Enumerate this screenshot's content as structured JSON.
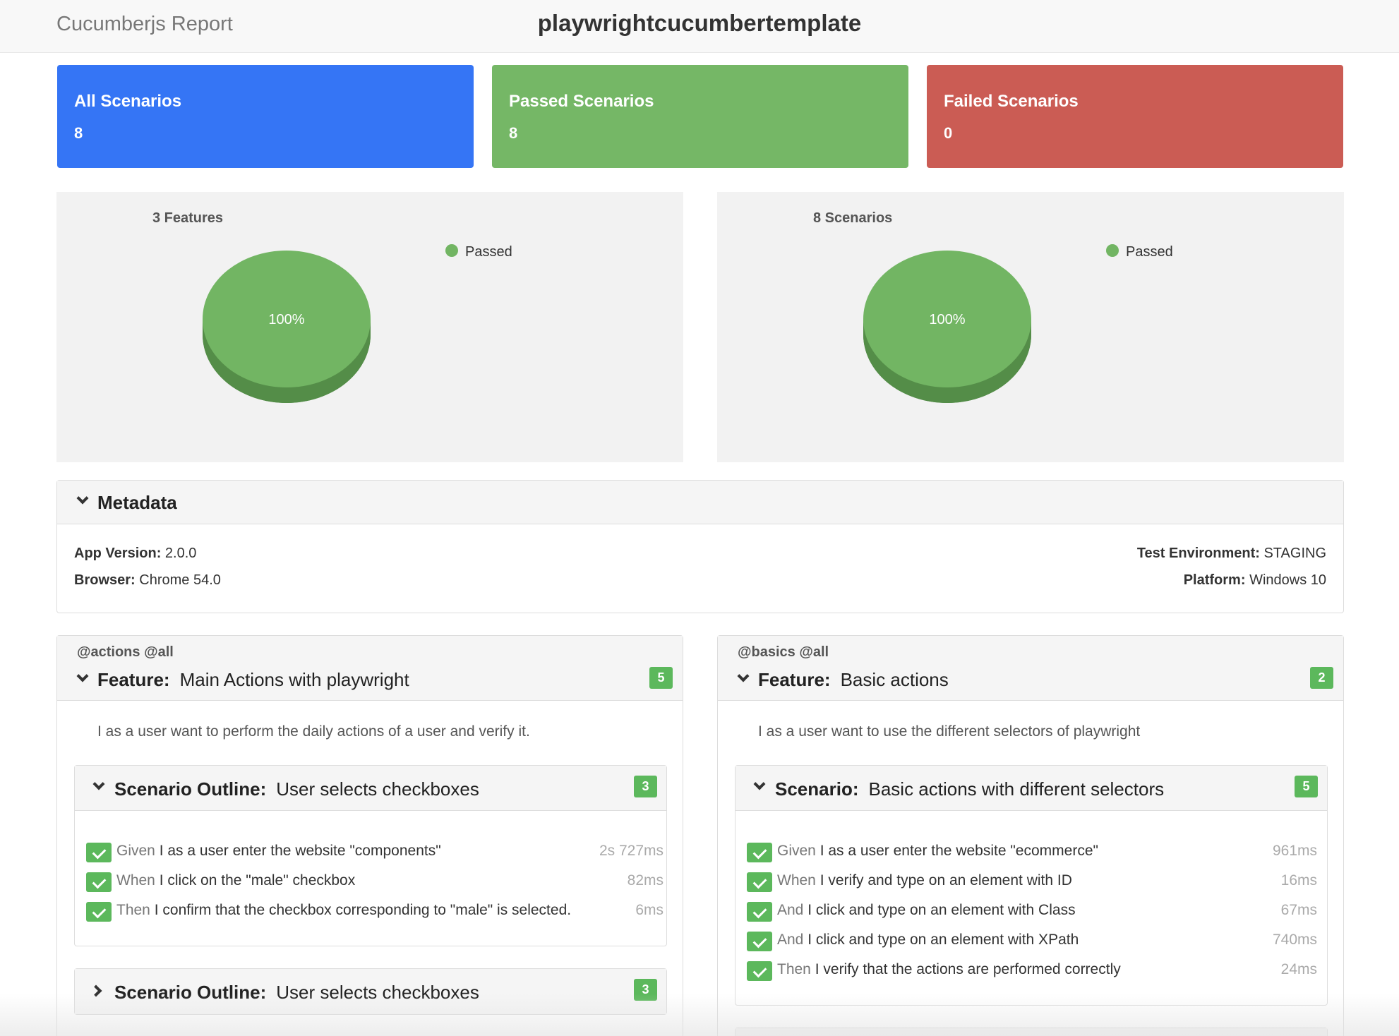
{
  "navbar": {
    "brand": "Cucumberjs Report",
    "title": "playwrightcucumbertemplate"
  },
  "tiles": [
    {
      "label": "All Scenarios",
      "count": "8",
      "color": "#3575f5"
    },
    {
      "label": "Passed Scenarios",
      "count": "8",
      "color": "#75b766"
    },
    {
      "label": "Failed Scenarios",
      "count": "0",
      "color": "#cb5c54"
    }
  ],
  "charts": [
    {
      "title": "3 Features",
      "legend": "Passed",
      "slice_label": "100%",
      "color": "#72b563"
    },
    {
      "title": "8 Scenarios",
      "legend": "Passed",
      "slice_label": "100%",
      "color": "#72b563"
    }
  ],
  "metadata": {
    "title": "Metadata",
    "app_version_label": "App Version:",
    "app_version": "2.0.0",
    "browser_label": "Browser:",
    "browser": "Chrome 54.0",
    "test_env_label": "Test Environment:",
    "test_env": "STAGING",
    "platform_label": "Platform:",
    "platform": "Windows 10"
  },
  "features": [
    {
      "tags": "@actions @all",
      "keyword": "Feature:",
      "name": "Main Actions with playwright",
      "count": "5",
      "description": "I as a user want to perform the daily actions of a user and verify it.",
      "scenarios": [
        {
          "keyword": "Scenario Outline:",
          "name": "User selects checkboxes",
          "count": "3",
          "steps": [
            {
              "keyword": "Given",
              "text": "I as a user enter the website \"components\"",
              "duration": "2s 727ms"
            },
            {
              "keyword": "When",
              "text": "I click on the \"male\" checkbox",
              "duration": "82ms"
            },
            {
              "keyword": "Then",
              "text": "I confirm that the checkbox corresponding to \"male\" is selected.",
              "duration": "6ms"
            }
          ]
        },
        {
          "keyword": "Scenario Outline:",
          "name": "User selects checkboxes",
          "count": "3"
        }
      ]
    },
    {
      "tags": "@basics @all",
      "keyword": "Feature:",
      "name": "Basic actions",
      "count": "2",
      "description": "I as a user want to use the different selectors of playwright",
      "scenarios": [
        {
          "keyword": "Scenario:",
          "name": "Basic actions with different selectors",
          "count": "5",
          "steps": [
            {
              "keyword": "Given",
              "text": "I as a user enter the website \"ecommerce\"",
              "duration": "961ms"
            },
            {
              "keyword": "When",
              "text": "I verify and type on an element with ID",
              "duration": "16ms"
            },
            {
              "keyword": "And",
              "text": "I click and type on an element with Class",
              "duration": "67ms"
            },
            {
              "keyword": "And",
              "text": "I click and type on an element with XPath",
              "duration": "740ms"
            },
            {
              "keyword": "Then",
              "text": "I verify that the actions are performed correctly",
              "duration": "24ms"
            }
          ]
        }
      ]
    }
  ]
}
